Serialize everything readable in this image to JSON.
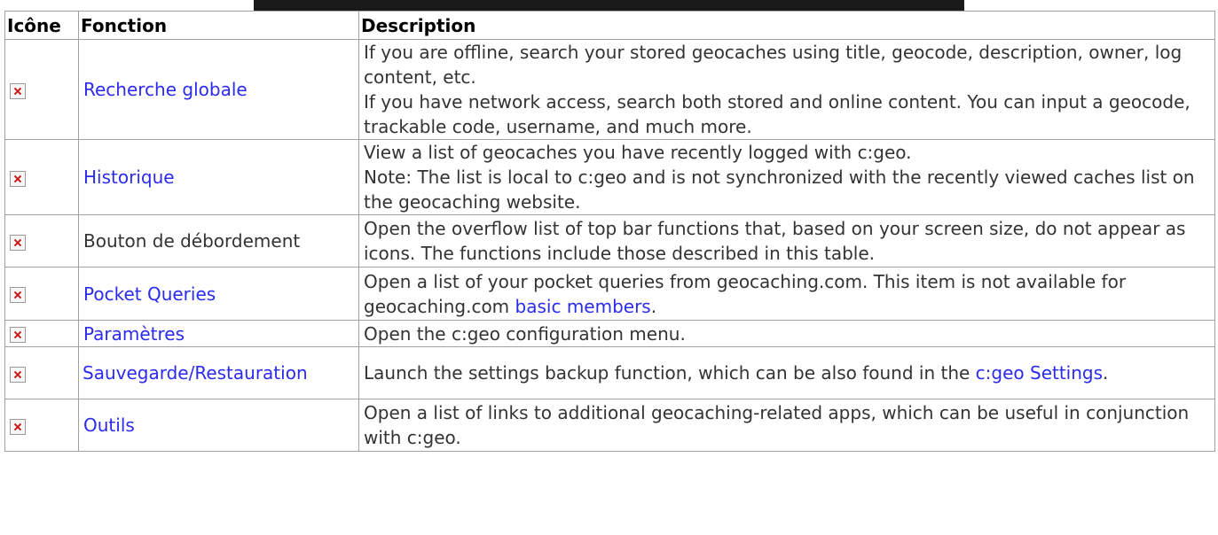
{
  "header": {
    "col_icon": "Icône",
    "col_function": "Fonction",
    "col_description": "Description"
  },
  "rows": [
    {
      "icon": "broken-image-icon",
      "function": "Recherche globale",
      "function_is_link": true,
      "desc": [
        {
          "text": "If you are offline, search your stored geocaches using title, geocode, description, owner, log content, etc."
        },
        {
          "text": "If you have network access, search both stored and online content. You can input a geocode, trackable code, username, and much more."
        }
      ]
    },
    {
      "icon": "broken-image-icon",
      "function": "Historique",
      "function_is_link": true,
      "desc": [
        {
          "text": "View a list of geocaches you have recently logged with c:geo."
        },
        {
          "text": "Note: The list is local to c:geo and is not synchronized with the recently viewed caches list on the geocaching website."
        }
      ]
    },
    {
      "icon": "broken-image-icon",
      "function": "Bouton de débordement",
      "function_is_link": false,
      "desc": [
        {
          "text": "Open the overflow list of top bar functions that, based on your screen size, do not appear as icons. The functions include those described in this table."
        }
      ]
    },
    {
      "icon": "broken-image-icon",
      "function": "Pocket Queries",
      "function_is_link": true,
      "desc_before": "Open a list of your pocket queries from geocaching.com. This item is not available for geocaching.com ",
      "desc_link": "basic members",
      "desc_after": "."
    },
    {
      "icon": "broken-image-icon",
      "function": "Paramètres",
      "function_is_link": true,
      "desc": [
        {
          "text": "Open the c:geo configuration menu."
        }
      ]
    },
    {
      "icon": "broken-image-icon",
      "function": "Sauvegarde/Restauration",
      "function_is_link": true,
      "desc_before": "Launch the settings backup function, which can be also found in the ",
      "desc_link": "c:geo Settings",
      "desc_after": "."
    },
    {
      "icon": "broken-image-icon",
      "function": "Outils",
      "function_is_link": true,
      "desc": [
        {
          "text": "Open a list of links to additional geocaching-related apps, which can be useful in conjunction with c:geo."
        }
      ]
    }
  ],
  "colors": {
    "link": "#2b2bef",
    "text": "#333333",
    "border": "#a0a0a0",
    "topbar": "#1a1a1a"
  }
}
